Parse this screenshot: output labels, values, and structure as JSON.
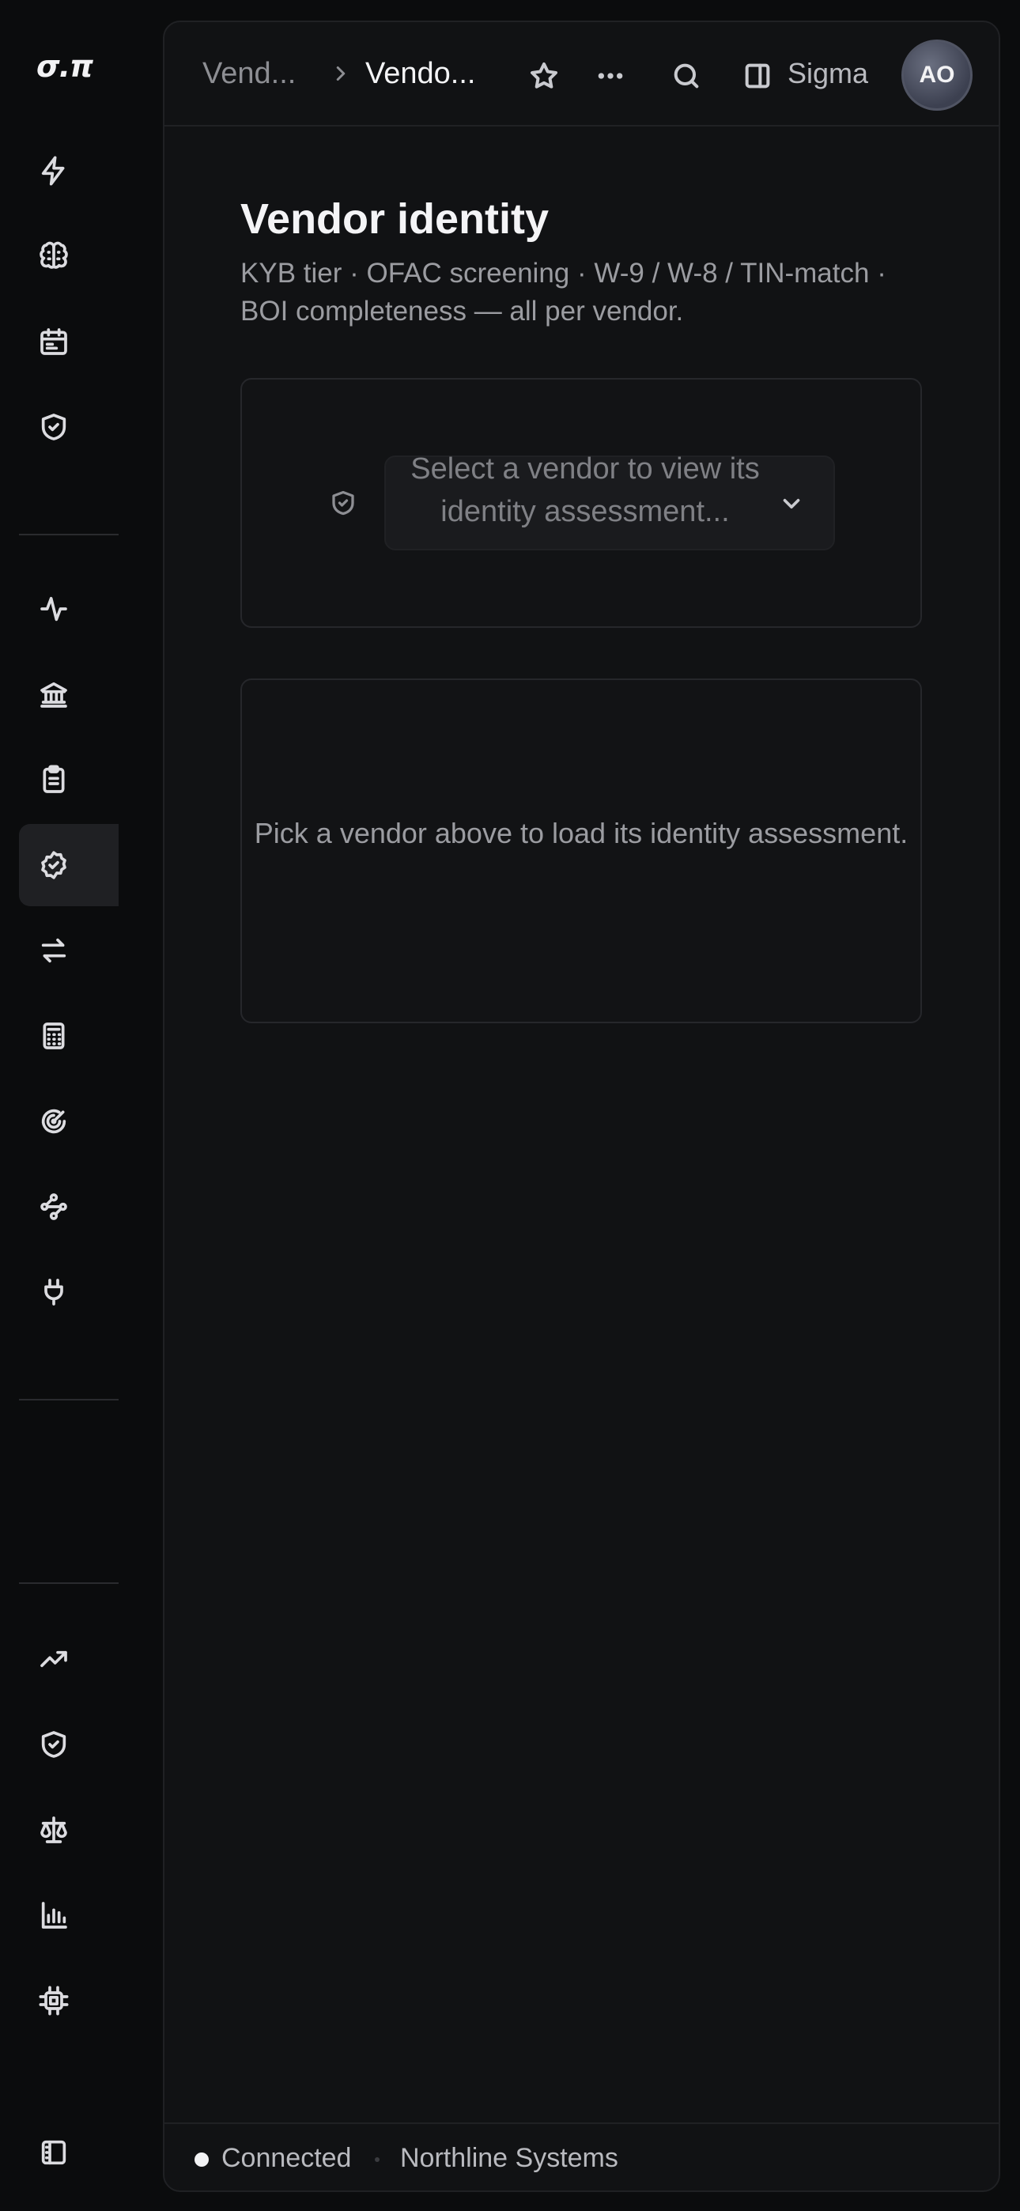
{
  "app": {
    "logo_text": "σ.π"
  },
  "sidebar": {
    "items": [
      {
        "id": "flash",
        "icon": "lightning-icon"
      },
      {
        "id": "brain",
        "icon": "brain-icon"
      },
      {
        "id": "calendar",
        "icon": "calendar-icon"
      },
      {
        "id": "shield",
        "icon": "shield-check-icon"
      },
      {
        "id": "activity",
        "icon": "activity-icon"
      },
      {
        "id": "bank",
        "icon": "bank-icon"
      },
      {
        "id": "clipboard",
        "icon": "clipboard-list-icon"
      },
      {
        "id": "vendor-identity",
        "icon": "badge-check-icon",
        "active": true
      },
      {
        "id": "transfer",
        "icon": "arrows-swap-icon"
      },
      {
        "id": "calculator",
        "icon": "calculator-icon"
      },
      {
        "id": "radar",
        "icon": "radar-icon"
      },
      {
        "id": "workflow",
        "icon": "workflow-icon"
      },
      {
        "id": "plug",
        "icon": "plug-icon"
      },
      {
        "id": "trend",
        "icon": "trending-up-icon"
      },
      {
        "id": "shield2",
        "icon": "shield-check-icon"
      },
      {
        "id": "scale",
        "icon": "scale-icon"
      },
      {
        "id": "bar-chart",
        "icon": "bar-chart-icon"
      },
      {
        "id": "chip",
        "icon": "cpu-chip-icon"
      },
      {
        "id": "panel",
        "icon": "sidebar-panel-icon"
      }
    ]
  },
  "topbar": {
    "breadcrumb_parent": "Vend...",
    "breadcrumb_current": "Vendo...",
    "workspace_label": "Sigma",
    "avatar_initials": "AO"
  },
  "page": {
    "title": "Vendor identity",
    "subtitle": "KYB tier · OFAC screening · W-9 / W-8 / TIN-match · BOI completeness — all per vendor."
  },
  "vendor_select": {
    "placeholder": "Select a vendor to view its identity assessment..."
  },
  "empty_state": {
    "message": "Pick a vendor above to load its identity assessment."
  },
  "statusbar": {
    "connection": "Connected",
    "organization": "Northline Systems"
  },
  "colors": {
    "background": "#0b0c0d",
    "panel": "#111214",
    "active_nav": "#1f2023",
    "text_primary": "#f4f4f6",
    "text_muted": "#9b9ca1"
  }
}
